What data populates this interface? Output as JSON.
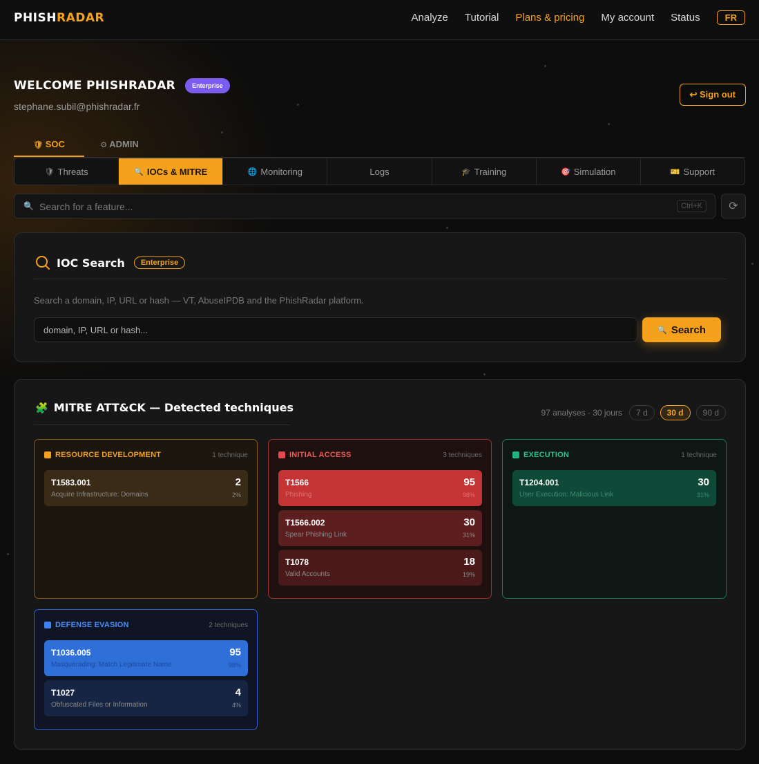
{
  "header": {
    "logo_a": "PHISH",
    "logo_b": "RADAR",
    "nav": [
      "Analyze",
      "Tutorial",
      "Plans & pricing",
      "My account",
      "Status"
    ],
    "lang": "FR"
  },
  "welcome": {
    "title": "WELCOME PHISHRADAR",
    "badge": "Enterprise",
    "email": "stephane.subil@phishradar.fr",
    "signout": "↩ Sign out"
  },
  "main_tabs": [
    "SOC",
    "ADMIN"
  ],
  "sub_tabs": [
    "Threats",
    "IOCs & MITRE",
    "Monitoring",
    "Logs",
    "Training",
    "Simulation",
    "Support"
  ],
  "feature_search": {
    "placeholder": "Search for a feature...",
    "shortcut": "Ctrl+K"
  },
  "ioc": {
    "title": "IOC Search",
    "badge": "Enterprise",
    "description": "Search a domain, IP, URL or hash — VT, AbuseIPDB and the PhishRadar platform.",
    "placeholder": "domain, IP, URL or hash...",
    "button": "Search"
  },
  "mitre": {
    "title": "MITRE ATT&CK — Detected techniques",
    "stat": "97 analyses · 30 jours",
    "periods": [
      "7 d",
      "30 d",
      "90 d"
    ],
    "active_period": "30 d",
    "tactics": [
      {
        "name": "RESOURCE DEVELOPMENT",
        "count": "1 technique",
        "color": "#f5a11b",
        "techniques": [
          {
            "id": "T1583.001",
            "name": "Acquire Infrastructure: Domains",
            "value": "2",
            "pct": "2%"
          }
        ]
      },
      {
        "name": "INITIAL ACCESS",
        "count": "3 techniques",
        "color": "#e5484d",
        "techniques": [
          {
            "id": "T1566",
            "name": "Phishing",
            "value": "95",
            "pct": "98%"
          },
          {
            "id": "T1566.002",
            "name": "Spear Phishing Link",
            "value": "30",
            "pct": "31%"
          },
          {
            "id": "T1078",
            "name": "Valid Accounts",
            "value": "18",
            "pct": "19%"
          }
        ]
      },
      {
        "name": "EXECUTION",
        "count": "1 technique",
        "color": "#1fb37f",
        "techniques": [
          {
            "id": "T1204.001",
            "name": "User Execution: Malicious Link",
            "value": "30",
            "pct": "31%"
          }
        ]
      },
      {
        "name": "DEFENSE EVASION",
        "count": "2 techniques",
        "color": "#3b82f6",
        "techniques": [
          {
            "id": "T1036.005",
            "name": "Masquerading: Match Legitimate Name",
            "value": "95",
            "pct": "98%"
          },
          {
            "id": "T1027",
            "name": "Obfuscated Files or Information",
            "value": "4",
            "pct": "4%"
          }
        ]
      }
    ]
  }
}
